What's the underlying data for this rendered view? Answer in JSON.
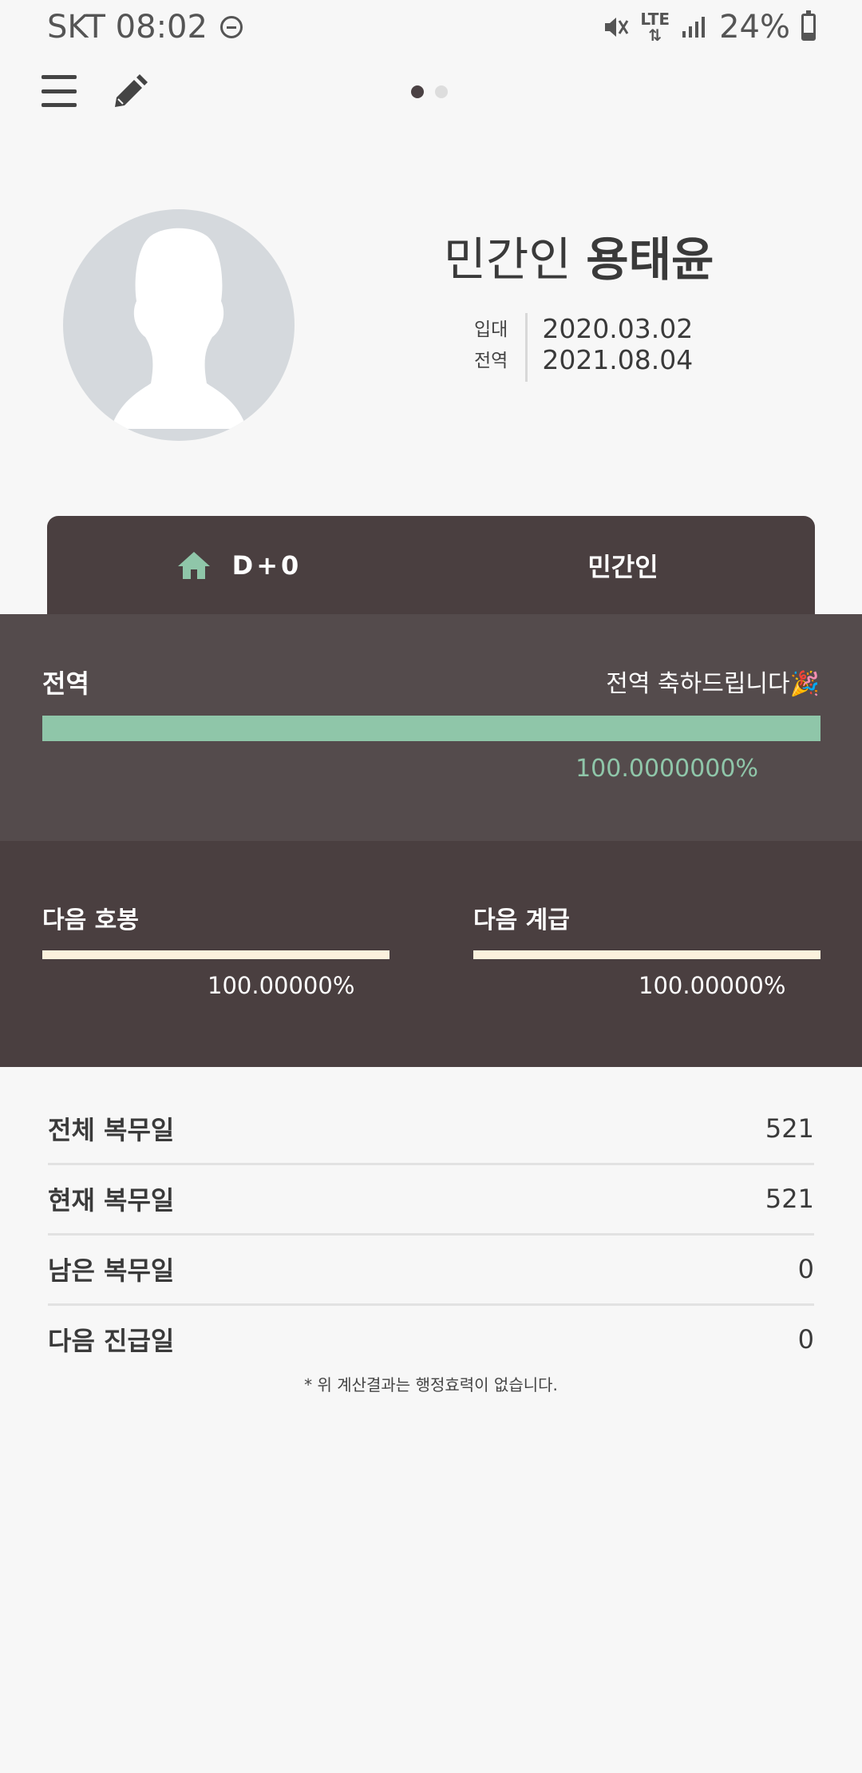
{
  "status_bar": {
    "carrier_time": "SKT 08:02",
    "network": "LTE",
    "battery": "24%",
    "battery_level": 0.24
  },
  "toolbar": {
    "pager_total": 2,
    "pager_active": 1
  },
  "profile": {
    "rank": "민간인",
    "name": "용태윤",
    "enlist_label": "입대",
    "enlist_date": "2020.03.02",
    "discharge_label": "전역",
    "discharge_date": "2021.08.04"
  },
  "tabs": {
    "dday": "D+0",
    "status": "민간인"
  },
  "discharge_progress": {
    "label": "전역",
    "message": "전역 축하드립니다🎉",
    "percent_text": "100.0000000%",
    "progress": 1.0
  },
  "next_pay_step": {
    "label": "다음 호봉",
    "percent_text": "100.00000%",
    "progress": 1.0
  },
  "next_rank": {
    "label": "다음 계급",
    "percent_text": "100.00000%",
    "progress": 1.0
  },
  "stats": [
    {
      "label": "전체 복무일",
      "value": "521"
    },
    {
      "label": "현재 복무일",
      "value": "521"
    },
    {
      "label": "남은 복무일",
      "value": "0"
    },
    {
      "label": "다음 진급일",
      "value": "0"
    }
  ],
  "note": "* 위 계산결과는 행정효력이 없습니다.",
  "colors": {
    "accent_green": "#8fc6a9",
    "cream_bar": "#fbf1dd",
    "dark_brown": "#4a3f40",
    "mid_brown": "#544b4c"
  }
}
